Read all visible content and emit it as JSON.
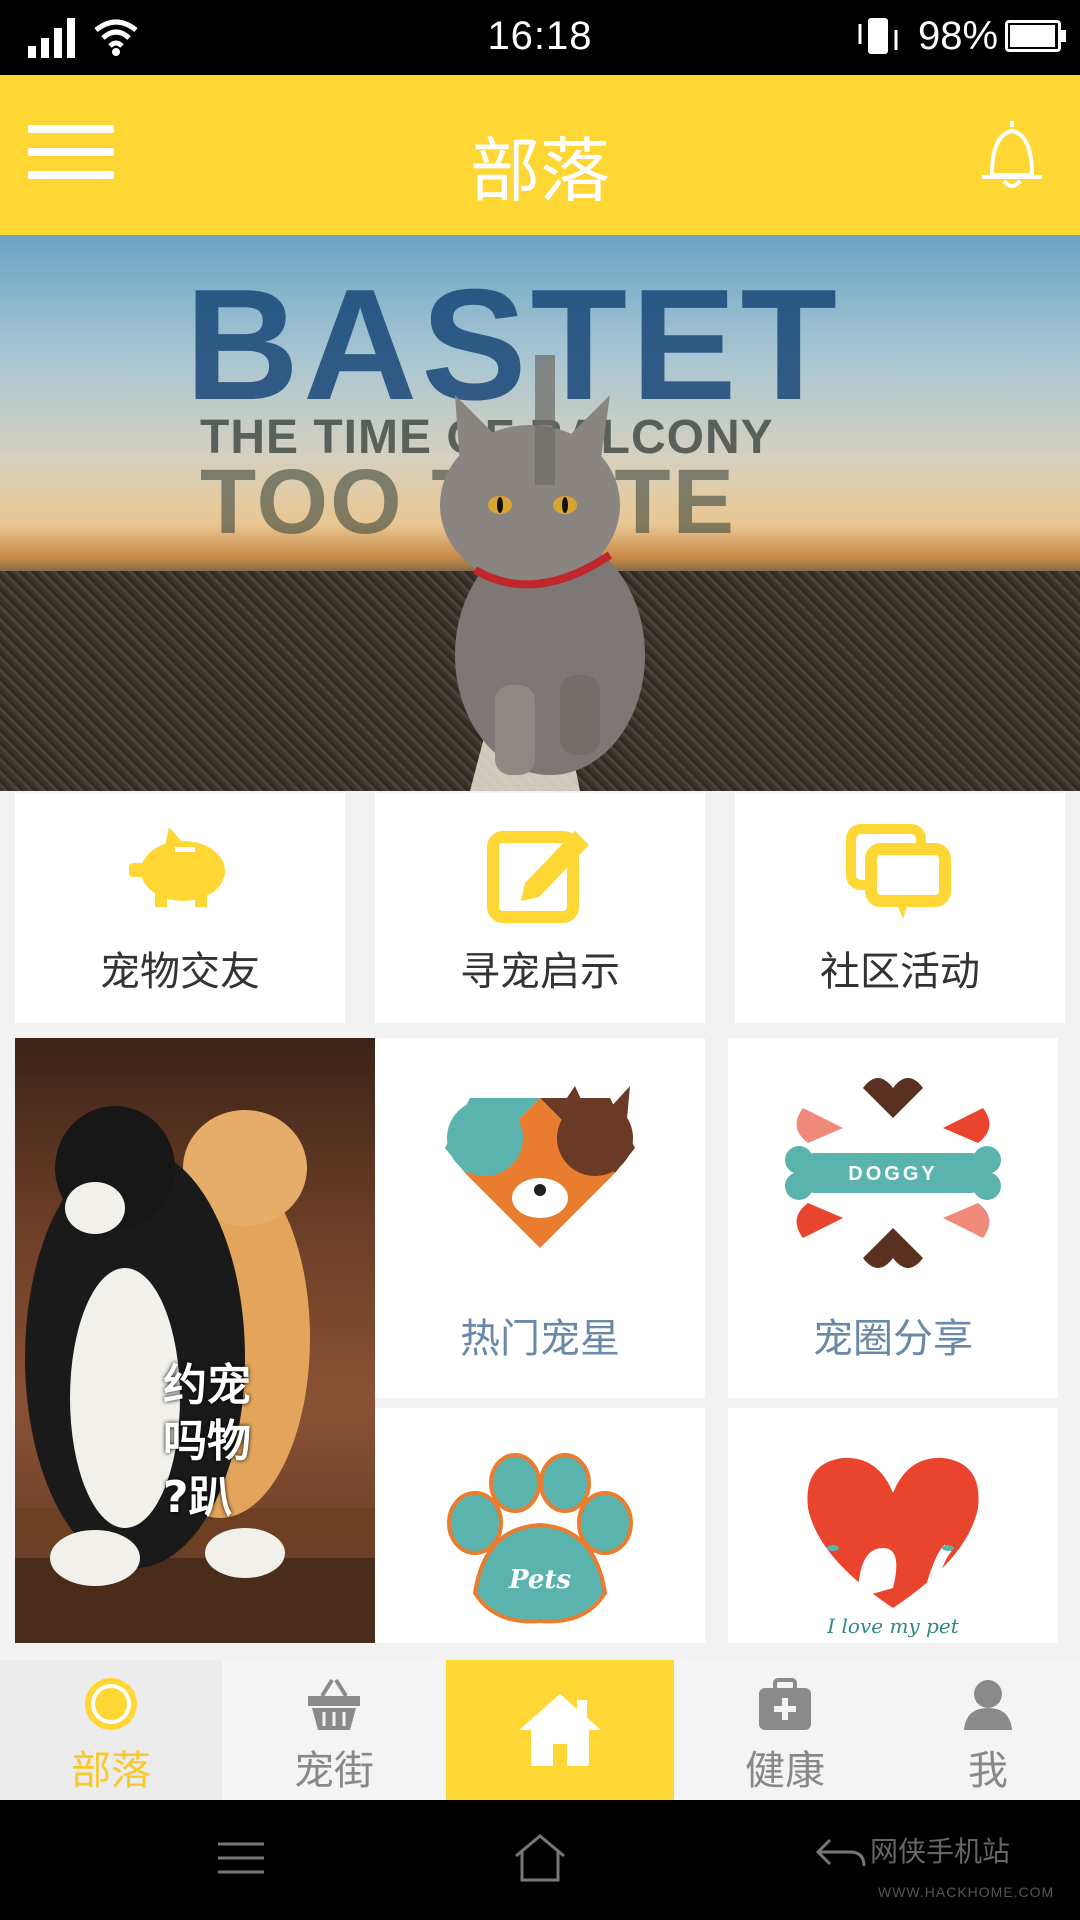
{
  "status_bar": {
    "time": "16:18",
    "battery_percent": "98%",
    "battery_level": 0.98
  },
  "header": {
    "title": "部落"
  },
  "banner": {
    "brand": "BASTET",
    "line1": "THE TIME OF BALCONY",
    "line2": "TOO TASTE"
  },
  "quick_actions": [
    {
      "label": "宠物交友",
      "icon": "piggy-bank-icon"
    },
    {
      "label": "寻宠启示",
      "icon": "edit-icon"
    },
    {
      "label": "社区活动",
      "icon": "chat-bubbles-icon"
    }
  ],
  "photo_tile": {
    "overlay_text": "约宠\n吗物\n?趴"
  },
  "tiles": [
    {
      "label": "热门宠星",
      "icon": "heart-animals-icon"
    },
    {
      "label": "宠圈分享",
      "icon": "doggy-bone-icon",
      "logo_text": "DOGGY"
    },
    {
      "label": "",
      "icon": "paw-icon",
      "logo_text": "Pets"
    },
    {
      "label": "",
      "icon": "dog-heart-icon",
      "logo_text": "I love my pet"
    }
  ],
  "bottom_nav": [
    {
      "label": "部落",
      "icon": "circle-icon",
      "active": true
    },
    {
      "label": "宠街",
      "icon": "basket-icon"
    },
    {
      "label": "",
      "icon": "home-icon",
      "highlighted": true
    },
    {
      "label": "健康",
      "icon": "medical-kit-icon"
    },
    {
      "label": "我",
      "icon": "user-icon"
    }
  ],
  "watermark": {
    "text": "网侠手机站",
    "sub": "WWW.HACKHOME.COM"
  },
  "colors": {
    "accent": "#fed735",
    "active_nav": "#f7c92b",
    "tile_label": "#6a88a8"
  }
}
